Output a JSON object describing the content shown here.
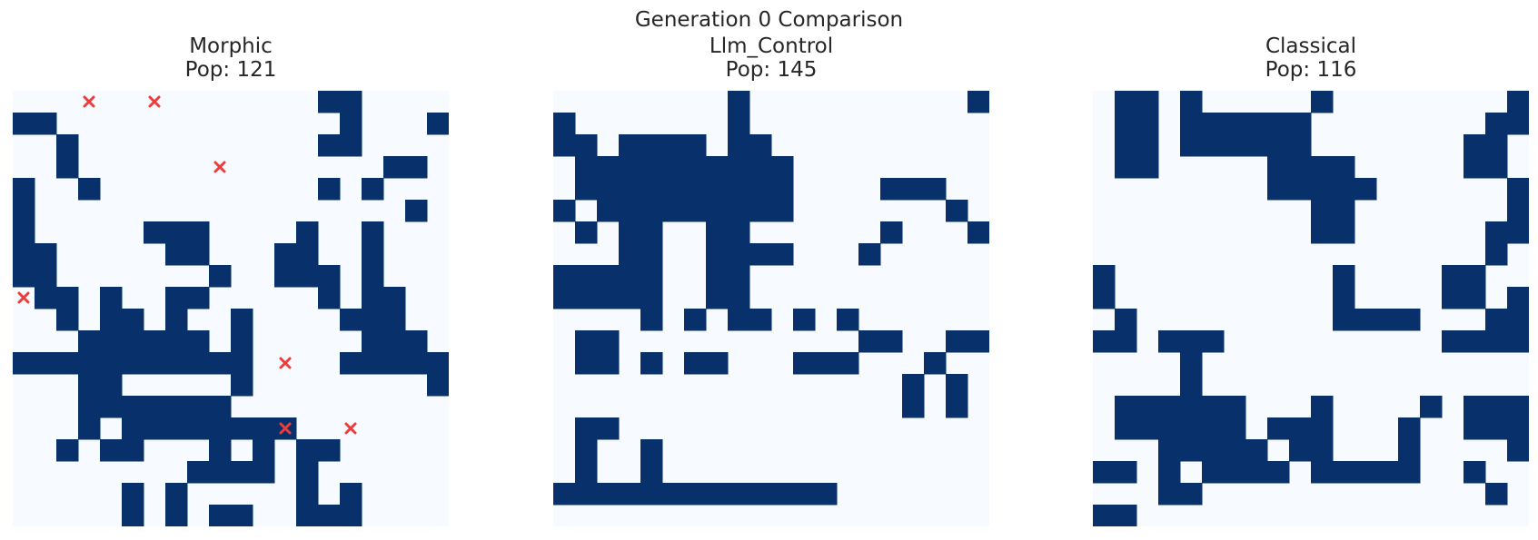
{
  "chart_data": {
    "suptitle": "Generation 0 Comparison",
    "type": "heatmap",
    "colors": {
      "alive": "#08306b",
      "dead": "#f7fbff",
      "marker": "#f03b3b"
    },
    "grid_size": [
      20,
      20
    ],
    "panels": [
      {
        "title": "Morphic",
        "subtitle": "Pop: 121",
        "grid": [
          "00000000000000110000",
          "11000000000000010001",
          "00100000000000110000",
          "00100000000000000110",
          "10010000000000101000",
          "10000000000000000010",
          "10000011100001001000",
          "11000001100011001000",
          "11000000010011101000",
          "01101001100000101100",
          "00101101001000011100",
          "00011111101000001110",
          "11111111111000011111",
          "00011000001000000001",
          "00011111110000000000",
          "00010111111110000000",
          "00101100010101100000",
          "00000000111101000000",
          "00000101000001010000",
          "00000101011001110000"
        ],
        "markers": [
          [
            3,
            0
          ],
          [
            6,
            0
          ],
          [
            9,
            3
          ],
          [
            0,
            9
          ],
          [
            12,
            12
          ],
          [
            12,
            15
          ],
          [
            15,
            15
          ]
        ]
      },
      {
        "title": "Llm_Control",
        "subtitle": "Pop: 145",
        "grid": [
          "00000000100000000001",
          "10000000100000000000",
          "11011110110000000000",
          "01111111111000000000",
          "01111111111000011100",
          "10111111111000000010",
          "01011001100000010001",
          "00011001111000100000",
          "11111001100000000000",
          "11111001100000000000",
          "00001010110101000000",
          "01100000000000110011",
          "01101011000111000100",
          "00000000000000001010",
          "00000000000000001010",
          "01100000000000000000",
          "01001000000000000000",
          "01001000000000000000",
          "11111111111110000000",
          "00000000000000000000"
        ],
        "markers": []
      },
      {
        "title": "Classical",
        "subtitle": "Pop: 116",
        "grid": [
          "01101000001000000001",
          "01101111110000000011",
          "01101111110000000110",
          "01100000111100000110",
          "00000000111110000001",
          "00000000001100000001",
          "00000000001100000011",
          "00000000000000000010",
          "10000000000100001100",
          "10000000000100001101",
          "01000000000111100011",
          "11011100000000001111",
          "00001000000000000000",
          "00001000000000000000",
          "01111110001000010111",
          "01111110111000100111",
          "00011111011000100001",
          "11010111101111100100",
          "00011000000000000010",
          "11000000000000000000"
        ],
        "markers": []
      }
    ]
  }
}
